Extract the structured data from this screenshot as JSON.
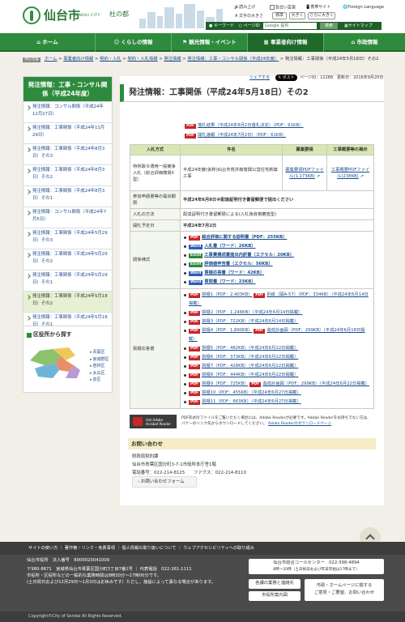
{
  "header": {
    "logo_jp": "仙台市",
    "logo_en": "SENDAI CITY",
    "logo_sub": "杜の都",
    "read_aloud": "読み上げ",
    "color_change": "色合い変更",
    "mobile": "携帯サイト",
    "foreign_language": "Foreign Language",
    "text_size_label": "文字の大きさ",
    "size_standard": "標準",
    "size_large": "大きく",
    "size_larger": "さらに大きく",
    "search_keyword": "キーワード",
    "search_page": "ページID",
    "search_placeholder": "Google 提供",
    "search_button": "検索",
    "sitemap": "サイトマップ"
  },
  "nav": [
    {
      "label": "ホーム"
    },
    {
      "label": "くらしの情報"
    },
    {
      "label": "観光情報・イベント"
    },
    {
      "label": "事業者向け情報"
    },
    {
      "label": "市政情報"
    }
  ],
  "breadcrumb": {
    "tag": "現在位置",
    "items": [
      "ホーム",
      "事業者向け情報",
      "契約・入札",
      "契約・入札情報",
      "発注情報",
      "発注情報：工事・コンサル関係（平成24年度）"
    ],
    "current": "発注情報：工事関係（平成24年5月18日）その2"
  },
  "sidebar": {
    "title": "発注情報：工事・コンサル関係（平成24年度）",
    "items": [
      {
        "label": "発注情報：コンサル関係（平成24年12月27日）"
      },
      {
        "label": "発注情報：工事関係（平成24年11月29日）"
      },
      {
        "label": "発注情報：工事関係（平成24年8月3日）その3"
      },
      {
        "label": "発注情報：工事関係（平成24年8月3日）その2"
      },
      {
        "label": "発注情報：工事関係（平成24年8月3日）その1"
      },
      {
        "label": "発注情報：コンサル関係（平成24年7月5日）"
      },
      {
        "label": "発注情報：工事関係（平成24年5月29日）その3"
      },
      {
        "label": "発注情報：工事関係（平成24年5月29日）その2"
      },
      {
        "label": "発注情報：工事関係（平成24年5月29日）その1"
      },
      {
        "label": "発注情報：工事関係（平成24年5月18日）その2"
      },
      {
        "label": "発注情報：工事関係（平成24年5月18日）その1"
      }
    ]
  },
  "area": {
    "title": "区役所から探す",
    "wards": [
      "青葉区",
      "宮城野区",
      "若林区",
      "太白区",
      "泉区"
    ]
  },
  "util": {
    "share": "シェアする",
    "post": "ポスト",
    "page_id": "ページID：12288",
    "updated": "更新日：2016年9月20日"
  },
  "page_title": "発注情報：工事関係（平成24年5月18日）その2",
  "top_links": [
    {
      "badge": "PDF",
      "text": "落札結果（平成24年8月2日落札決定）（PDF：61KB）"
    },
    {
      "badge": "PDF",
      "text": "開札速報（平成24年7月2日）（PDF：61KB）"
    }
  ],
  "table": {
    "headers": [
      "入札方式",
      "件名",
      "募集要領",
      "工事概要等の掲示"
    ],
    "method": "特例政令適用一般競争入札（総合評価簡易II型）",
    "subject": "平成24年度(仮称)仙台市荒井南復興公営住宅新築工事",
    "youryou": "募集要領PDFファイル(1,173KB)",
    "gaiyou": "工事概要PDFファイル(238KB)",
    "rows": [
      {
        "label": "参加申請書等の提出期限",
        "value": "平成24年6月8日※配達証明付き書留郵便で提出ください"
      },
      {
        "label": "入札の方法",
        "value": "配達証明付き書留郵便による(入札後資格審査型)"
      },
      {
        "label": "開札予定日",
        "value": "平成24年7月2日"
      }
    ],
    "forms_label": "関係様式",
    "forms": [
      {
        "badge": "PDF",
        "text": "総合評価に関する説明書（PDF：255KB）"
      },
      {
        "badge": "Word",
        "text": "入札書（ワード：26KB）"
      },
      {
        "badge": "Excel",
        "text": "工事費構成書提出内訳書（エクセル：20KB）"
      },
      {
        "badge": "Excel",
        "text": "評価値申告書（エクセル：56KB）"
      },
      {
        "badge": "Word",
        "text": "質疑応答書（ワード：42KB）"
      },
      {
        "badge": "Word",
        "text": "質問書（ワード：23KB）"
      }
    ],
    "qa_label": "質疑応答書",
    "qa": [
      {
        "text": "質疑1（PDF：2,403KB）",
        "extra": "別紙（図A-57）（PDF：334KB）（平成24年6月14日掲載）"
      },
      {
        "text": "質疑2（PDF：1,248KB）（平成24年6月14日掲載）",
        "extra": ""
      },
      {
        "text": "質疑3（PDF：722KB）（平成24年6月14日掲載）",
        "extra": ""
      },
      {
        "text": "質疑4（PDF：1,890KB）",
        "extra": "造成計画図（PDF：299KB）（平成24年6月18日掲載）"
      },
      {
        "text": "質疑5（PDF：482KB）（平成24年6月22日掲載）",
        "extra": ""
      },
      {
        "text": "質疑6（PDF：373KB）（平成24年6月22日掲載）",
        "extra": ""
      },
      {
        "text": "質疑7（PDF：428KB）（平成24年6月22日掲載）",
        "extra": ""
      },
      {
        "text": "質疑8（PDF：444KB）（平成24年6月22日掲載）",
        "extra": ""
      },
      {
        "text": "質疑9（PDF：725KB）",
        "extra": "造成計画図（PDF：299KB）（平成24年6月22日掲載）"
      },
      {
        "text": "質疑10（PDF：455KB）（平成24年6月27日掲載）",
        "extra": ""
      },
      {
        "text": "質疑11（PDF：663KB）（平成24年6月27日掲載）",
        "extra": ""
      }
    ]
  },
  "adobe": {
    "badge_line1": "Get Adobe",
    "badge_line2": "Acrobat Reader",
    "text": "PDF形式のファイルをご覧いただく場合には、Adobe Readerが必要です。Adobe Readerをお持ちでない方は、バナーのリンク先からダウンロードしてください。",
    "link": "Adobe Readerのダウンロードページ"
  },
  "inquiry": {
    "title": "お問い合わせ",
    "dept": "財政局契約課",
    "address": "仙台市青葉区国分町3-7-1市役所本庁舎1階",
    "phone": "電話番号：022-214-8125　　ファクス：022-214-8110",
    "form_button": "お問い合わせフォーム"
  },
  "footer": {
    "links": "サイトの使い方 ｜ 著作権・リンク・免責事項 ｜ 個人情報の取り扱いについて ｜ ウェブアクセシビリティへの取り組み",
    "office": "仙台市役所　法人番号　8000020041009",
    "address": "〒980-8671　宮城県仙台市青葉区国分町3丁目7番1号 ｜ 代表電話　022-261-1111",
    "hours1": "市役所・区役所などの一般的な業務時間は8時30分～17時00分です。",
    "hours2": "(土日祝日および12月29日～1月3日はお休みです）ただし、施設によって異なる場合があります。",
    "callcenter": "仙台市総合コールセンター　022-398-4894",
    "callcenter_hours": "8時～20時（土日祝日および年末年始は17時まで）",
    "btn_dept": "各課の業務と連絡先",
    "btn_map": "市役所案内図",
    "btn_opinion1": "市政・ホームページに関する",
    "btn_opinion2": "ご意見・ご要望、お問い合わせ",
    "copyright": "Copyright©City of Sendai All Rights Reserved."
  }
}
